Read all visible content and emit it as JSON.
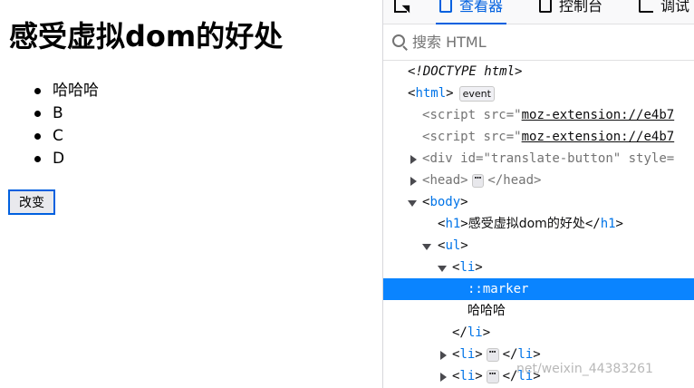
{
  "page": {
    "heading": "感受虚拟dom的好处",
    "list_items": [
      "哈哈哈",
      "B",
      "C",
      "D"
    ],
    "change_button_label": "改变"
  },
  "devtools": {
    "tabs": [
      {
        "label": "",
        "icon": "element-picker-icon"
      },
      {
        "label": "查看器",
        "icon": "inspector-icon",
        "active": true
      },
      {
        "label": "控制台",
        "icon": "console-icon"
      },
      {
        "label": "调试",
        "icon": "debugger-icon"
      }
    ],
    "search": {
      "placeholder": "搜索 HTML",
      "value": ""
    },
    "tree": {
      "doctype": "<!DOCTYPE html>",
      "html_tag": "html",
      "event_badge": "event",
      "script1_tag": "script",
      "script1_attr": "src",
      "script1_val": "moz-extension://e4b7",
      "script2_tag": "script",
      "script2_attr": "src",
      "script2_val": "moz-extension://e4b7",
      "div_tag": "div",
      "div_attr": "id",
      "div_val": "translate-button",
      "div_attr2": "style=",
      "head_tag": "head",
      "body_tag": "body",
      "h1_tag": "h1",
      "h1_text": "感受虚拟dom的好处",
      "ul_tag": "ul",
      "li_tag": "li",
      "marker": "::marker",
      "li_text": "哈哈哈",
      "ellipsis": "⋯"
    }
  },
  "watermark": "net/weixin_44383261",
  "colors": {
    "accent": "#0060df",
    "selection": "#0a84ff",
    "tag": "#0074e8"
  }
}
